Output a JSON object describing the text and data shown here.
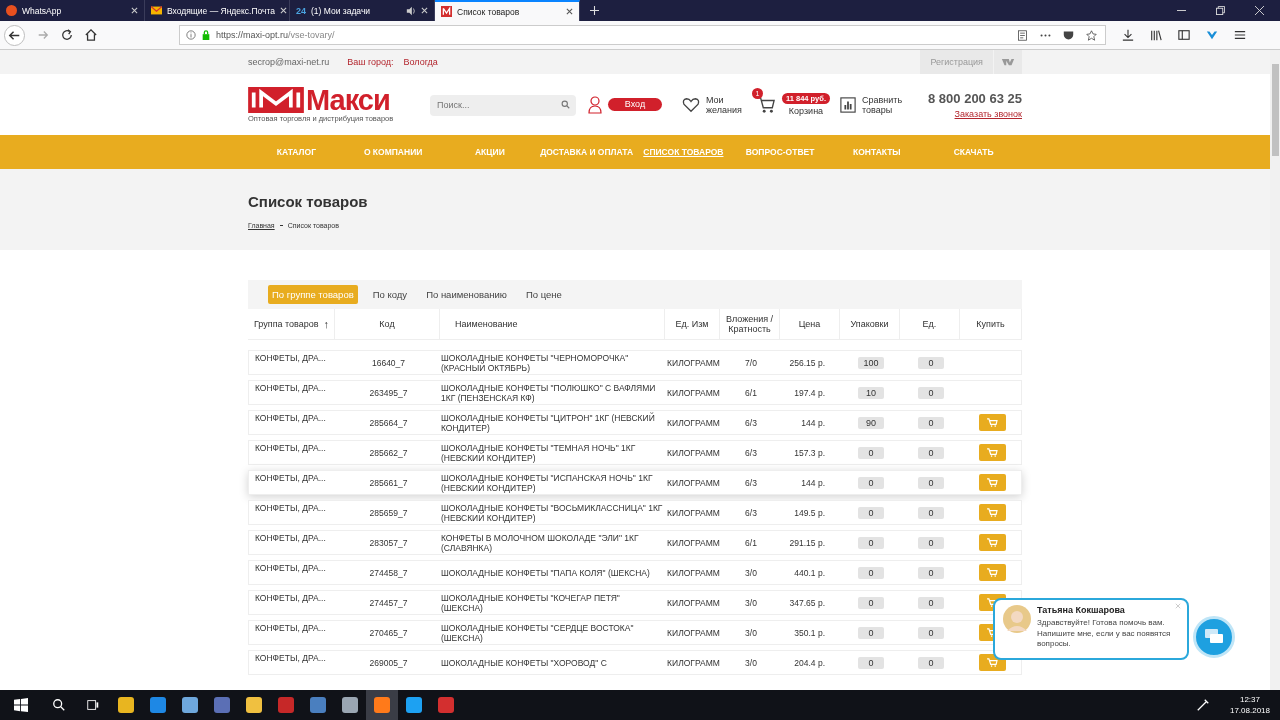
{
  "browser": {
    "tabs": [
      {
        "kind": "whatsapp",
        "title": "WhatsApp",
        "selected": false,
        "audio": false
      },
      {
        "kind": "mail",
        "title": "Входящие — Яндекс.Почта",
        "selected": false,
        "audio": false
      },
      {
        "kind": "tasks",
        "title": "(1) Мои задачи",
        "badge": "24",
        "selected": false,
        "audio": true
      },
      {
        "kind": "site",
        "title": "Список товаров",
        "selected": true,
        "audio": false
      }
    ],
    "url_host": "https://maxi-opt.ru",
    "url_path": "/vse-tovary/"
  },
  "topbar": {
    "email": "secrop@maxi-net.ru",
    "city_label": "Ваш город:",
    "city": "Вологда",
    "register": "Регистрация"
  },
  "header": {
    "logo_text": "Макси",
    "tagline": "Оптовая торговля и дистрибуция товаров",
    "search": {
      "placeholder": "Поиск..."
    },
    "login": "Вход",
    "wishlist": "Мои желания",
    "cart_count": "1",
    "cart_total": "11 844 руб.",
    "cart": "Корзина",
    "compare": "Сравнить товары",
    "phone": "8 800 200 63 25",
    "callback": "Заказать звонок"
  },
  "nav": [
    {
      "label": "КАТАЛОГ",
      "selected": false
    },
    {
      "label": "О КОМПАНИИ",
      "selected": false
    },
    {
      "label": "АКЦИИ",
      "selected": false
    },
    {
      "label": "ДОСТАВКА И ОПЛАТА",
      "selected": false
    },
    {
      "label": "СПИСОК ТОВАРОВ",
      "selected": true
    },
    {
      "label": "ВОПРОС-ОТВЕТ",
      "selected": false
    },
    {
      "label": "КОНТАКТЫ",
      "selected": false
    },
    {
      "label": "СКАЧАТЬ",
      "selected": false
    }
  ],
  "page": {
    "title": "Список товаров",
    "breadcrumbs": [
      {
        "label": "Главная",
        "link": true
      },
      {
        "label": "Список товаров",
        "link": false
      }
    ]
  },
  "sort_tabs": [
    {
      "label": "По группе товаров",
      "selected": true
    },
    {
      "label": "По коду",
      "selected": false
    },
    {
      "label": "По наименованию",
      "selected": false
    },
    {
      "label": "По цене",
      "selected": false
    }
  ],
  "table": {
    "columns": [
      "Группа товаров",
      "Код",
      "Наименование",
      "Ед. Изм",
      "Вложения /Кратность",
      "Цена",
      "Упаковки",
      "Ед.",
      "Купить"
    ],
    "sort_arrow": "↑",
    "rows": [
      {
        "group": "КОНФЕТЫ, ДРА...",
        "code": "16640_7",
        "name": "ШОКОЛАДНЫЕ КОНФЕТЫ \"ЧЕРНОМОРОЧКА\" (КРАСНЫЙ ОКТЯБРЬ)",
        "unit": "КИЛОГРАММ",
        "pack": "7/0",
        "price": "256.15 р.",
        "packs": "100",
        "units": "0",
        "buyable": false,
        "hovered": false
      },
      {
        "group": "КОНФЕТЫ, ДРА...",
        "code": "263495_7",
        "name": "ШОКОЛАДНЫЕ КОНФЕТЫ \"ПОЛЮШКО\" С ВАФЛЯМИ 1КГ (ПЕНЗЕНСКАЯ КФ)",
        "unit": "КИЛОГРАММ",
        "pack": "6/1",
        "price": "197.4 р.",
        "packs": "10",
        "units": "0",
        "buyable": false,
        "hovered": false
      },
      {
        "group": "КОНФЕТЫ, ДРА...",
        "code": "285664_7",
        "name": "ШОКОЛАДНЫЕ КОНФЕТЫ \"ЦИТРОН\" 1КГ (НЕВСКИЙ КОНДИТЕР)",
        "unit": "КИЛОГРАММ",
        "pack": "6/3",
        "price": "144 р.",
        "packs": "90",
        "units": "0",
        "buyable": true,
        "hovered": false
      },
      {
        "group": "КОНФЕТЫ, ДРА...",
        "code": "285662_7",
        "name": "ШОКОЛАДНЫЕ КОНФЕТЫ \"ТЕМНАЯ НОЧЬ\" 1КГ (НЕВСКИЙ КОНДИТЕР)",
        "unit": "КИЛОГРАММ",
        "pack": "6/3",
        "price": "157.3 р.",
        "packs": "0",
        "units": "0",
        "buyable": true,
        "hovered": false
      },
      {
        "group": "КОНФЕТЫ, ДРА...",
        "code": "285661_7",
        "name": "ШОКОЛАДНЫЕ КОНФЕТЫ \"ИСПАНСКАЯ НОЧЬ\" 1КГ (НЕВСКИЙ КОНДИТЕР)",
        "unit": "КИЛОГРАММ",
        "pack": "6/3",
        "price": "144 р.",
        "packs": "0",
        "units": "0",
        "buyable": true,
        "hovered": true
      },
      {
        "group": "КОНФЕТЫ, ДРА...",
        "code": "285659_7",
        "name": "ШОКОЛАДНЫЕ КОНФЕТЫ \"ВОСЬМИКЛАССНИЦА\" 1КГ (НЕВСКИЙ КОНДИТЕР)",
        "unit": "КИЛОГРАММ",
        "pack": "6/3",
        "price": "149.5 р.",
        "packs": "0",
        "units": "0",
        "buyable": true,
        "hovered": false
      },
      {
        "group": "КОНФЕТЫ, ДРА...",
        "code": "283057_7",
        "name": "КОНФЕТЫ В МОЛОЧНОМ ШОКОЛАДЕ \"ЭЛИ\" 1КГ (СЛАВЯНКА)",
        "unit": "КИЛОГРАММ",
        "pack": "6/1",
        "price": "291.15 р.",
        "packs": "0",
        "units": "0",
        "buyable": true,
        "hovered": false
      },
      {
        "group": "КОНФЕТЫ, ДРА...",
        "code": "274458_7",
        "name": "ШОКОЛАДНЫЕ КОНФЕТЫ \"ПАПА КОЛЯ\" (ШЕКСНА)",
        "unit": "КИЛОГРАММ",
        "pack": "3/0",
        "price": "440.1 р.",
        "packs": "0",
        "units": "0",
        "buyable": true,
        "hovered": false
      },
      {
        "group": "КОНФЕТЫ, ДРА...",
        "code": "274457_7",
        "name": "ШОКОЛАДНЫЕ КОНФЕТЫ \"КОЧЕГАР ПЕТЯ\" (ШЕКСНА)",
        "unit": "КИЛОГРАММ",
        "pack": "3/0",
        "price": "347.65 р.",
        "packs": "0",
        "units": "0",
        "buyable": true,
        "hovered": false
      },
      {
        "group": "КОНФЕТЫ, ДРА...",
        "code": "270465_7",
        "name": "ШОКОЛАДНЫЕ КОНФЕТЫ \"СЕРДЦЕ ВОСТОКА\" (ШЕКСНА)",
        "unit": "КИЛОГРАММ",
        "pack": "3/0",
        "price": "350.1 р.",
        "packs": "0",
        "units": "0",
        "buyable": true,
        "hovered": false
      },
      {
        "group": "КОНФЕТЫ, ДРА...",
        "code": "269005_7",
        "name": "ШОКОЛАДНЫЕ КОНФЕТЫ \"ХОРОВОД\" С",
        "unit": "КИЛОГРАММ",
        "pack": "3/0",
        "price": "204.4 р.",
        "packs": "0",
        "units": "0",
        "buyable": true,
        "hovered": false
      }
    ]
  },
  "chat": {
    "name": "Татьяна Кокшарова",
    "message": "Здравствуйте! Готова помочь вам. Напишите мне, если у вас появятся вопросы."
  },
  "taskbar": {
    "time": "12:37",
    "date": "17.08.2018"
  }
}
